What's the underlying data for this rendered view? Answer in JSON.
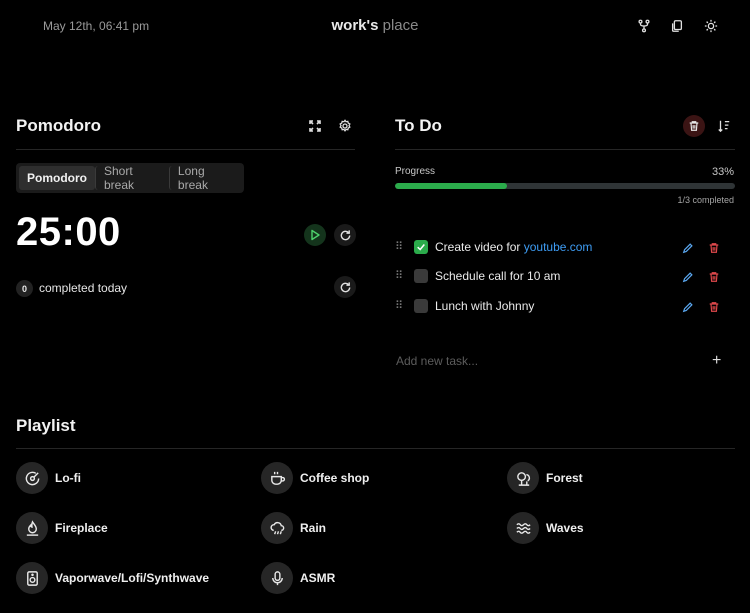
{
  "header": {
    "date_time": "May 12th, 06:41 pm",
    "title_part1": "work's",
    "title_part2": "place",
    "icons": [
      "moon-logo-icon",
      "fork-icon",
      "copy-icon",
      "sun-icon"
    ]
  },
  "pomodoro": {
    "title": "Pomodoro",
    "tabs": [
      {
        "label": "Pomodoro",
        "active": true
      },
      {
        "label": "Short break",
        "active": false
      },
      {
        "label": "Long break",
        "active": false
      }
    ],
    "timer": "25:00",
    "completed_count": "0",
    "completed_label": "completed today"
  },
  "todo": {
    "title": "To Do",
    "progress_label": "Progress",
    "progress_percent": "33%",
    "progress_value": 0.33,
    "progress_sub": "1/3 completed",
    "tasks": [
      {
        "text": "Create video for ",
        "link": "youtube.com",
        "done": true
      },
      {
        "text": "Schedule call for 10 am",
        "done": false
      },
      {
        "text": "Lunch with Johnny",
        "done": false
      }
    ],
    "add_placeholder": "Add new task...",
    "add_icon": "+"
  },
  "playlist": {
    "title": "Playlist",
    "items": [
      {
        "label": "Lo-fi",
        "icon": "vinyl-icon"
      },
      {
        "label": "Coffee shop",
        "icon": "coffee-icon"
      },
      {
        "label": "Forest",
        "icon": "trees-icon"
      },
      {
        "label": "Fireplace",
        "icon": "flame-icon"
      },
      {
        "label": "Rain",
        "icon": "rain-cloud-icon"
      },
      {
        "label": "Waves",
        "icon": "waves-icon"
      },
      {
        "label": "Vaporwave/Lofi/Synthwave",
        "icon": "speaker-icon"
      },
      {
        "label": "ASMR",
        "icon": "microphone-icon"
      }
    ]
  },
  "colors": {
    "background": "#000000",
    "accent_green": "#2bab4b",
    "link_blue": "#3e9cf3",
    "delete_red": "#e0484b",
    "edit_blue": "#5aa7f0"
  }
}
